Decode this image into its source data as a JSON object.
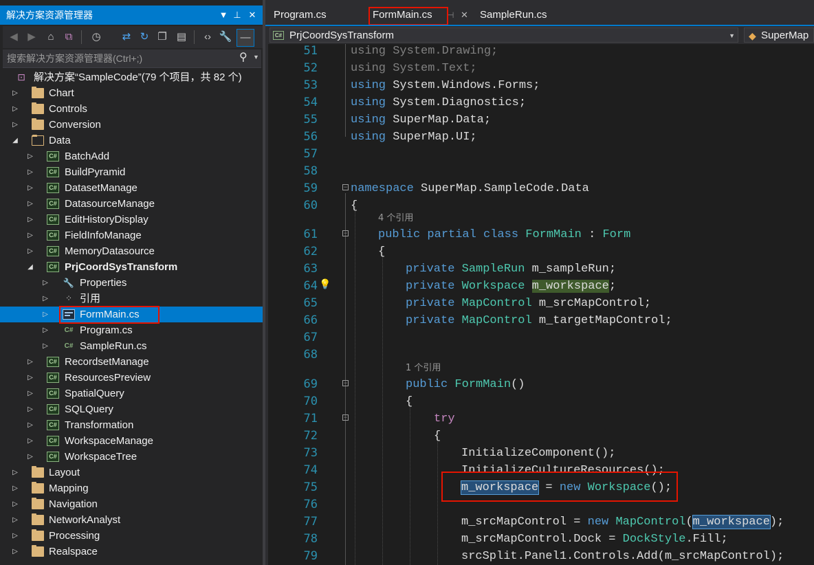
{
  "solution_explorer": {
    "title": "解决方案资源管理器",
    "search_placeholder": "搜索解决方案资源管理器(Ctrl+;)",
    "solution_label": "解决方案“SampleCode”(79 个项目，共 82 个)",
    "items": [
      {
        "label": "Chart",
        "type": "folder"
      },
      {
        "label": "Controls",
        "type": "folder"
      },
      {
        "label": "Conversion",
        "type": "folder"
      },
      {
        "label": "Data",
        "type": "folder"
      },
      {
        "label": "BatchAdd",
        "type": "csproj"
      },
      {
        "label": "BuildPyramid",
        "type": "csproj"
      },
      {
        "label": "DatasetManage",
        "type": "csproj"
      },
      {
        "label": "DatasourceManage",
        "type": "csproj"
      },
      {
        "label": "EditHistoryDisplay",
        "type": "csproj"
      },
      {
        "label": "FieldInfoManage",
        "type": "csproj"
      },
      {
        "label": "MemoryDatasource",
        "type": "csproj"
      },
      {
        "label": "PrjCoordSysTransform",
        "type": "csproj"
      },
      {
        "label": "Properties",
        "type": "properties"
      },
      {
        "label": "引用",
        "type": "references"
      },
      {
        "label": "FormMain.cs",
        "type": "form"
      },
      {
        "label": "Program.cs",
        "type": "csfile"
      },
      {
        "label": "SampleRun.cs",
        "type": "csfile"
      },
      {
        "label": "RecordsetManage",
        "type": "csproj"
      },
      {
        "label": "ResourcesPreview",
        "type": "csproj"
      },
      {
        "label": "SpatialQuery",
        "type": "csproj"
      },
      {
        "label": "SQLQuery",
        "type": "csproj"
      },
      {
        "label": "Transformation",
        "type": "csproj"
      },
      {
        "label": "WorkspaceManage",
        "type": "csproj"
      },
      {
        "label": "WorkspaceTree",
        "type": "csproj"
      },
      {
        "label": "Layout",
        "type": "folder"
      },
      {
        "label": "Mapping",
        "type": "folder"
      },
      {
        "label": "Navigation",
        "type": "folder"
      },
      {
        "label": "NetworkAnalyst",
        "type": "folder"
      },
      {
        "label": "Processing",
        "type": "folder"
      },
      {
        "label": "Realspace",
        "type": "folder"
      }
    ]
  },
  "editor": {
    "tabs": [
      {
        "label": "Program.cs"
      },
      {
        "label": "FormMain.cs"
      },
      {
        "label": "SampleRun.cs"
      }
    ],
    "nav_project": "PrjCoordSysTransform",
    "nav_member": "SuperMap",
    "line_numbers": [
      "51",
      "52",
      "53",
      "54",
      "55",
      "56",
      "57",
      "58",
      "59",
      "60",
      "61",
      "62",
      "63",
      "64",
      "65",
      "66",
      "67",
      "68",
      "69",
      "70",
      "71",
      "72",
      "73",
      "74",
      "75",
      "76",
      "77",
      "78",
      "79"
    ],
    "refs": {
      "class_refs": "4 个引用",
      "ctor_refs": "1 个引用"
    },
    "code": {
      "l51_kw": "using",
      "l51_rest": " System.Drawing;",
      "l52_kw": "using",
      "l52_rest": " System.Text;",
      "l53_kw": "using",
      "l53_rest": " System.Windows.Forms;",
      "l54_kw": "using",
      "l54_rest": " System.Diagnostics;",
      "l55_kw": "using",
      "l55_rest": " SuperMap.Data;",
      "l56_kw": "using",
      "l56_rest": " SuperMap.UI;",
      "l59_kw": "namespace",
      "l59_rest": " SuperMap.SampleCode.Data",
      "brace_open": "{",
      "l61_kw": "public partial class",
      "l61_ty": " FormMain",
      "l61_mid": " : ",
      "l61_ty2": "Form",
      "l63_kw": "private",
      "l63_ty": " SampleRun",
      "l63_rest": " m_sampleRun;",
      "l64_kw": "private",
      "l64_ty": " Workspace",
      "l64_sp": " ",
      "l64_hl": "m_workspace",
      "l64_end": ";",
      "l65_kw": "private",
      "l65_ty": " MapControl",
      "l65_rest": " m_srcMapControl;",
      "l66_kw": "private",
      "l66_ty": " MapControl",
      "l66_rest": " m_targetMapControl;",
      "l69_kw": "public",
      "l69_ty": " FormMain",
      "l69_rest": "()",
      "l71_kw": "try",
      "l73": "InitializeComponent();",
      "l74": "InitializeCultureResources();",
      "l75_hl": "m_workspace",
      "l75_mid": " = ",
      "l75_kw": "new",
      "l75_ty": " Workspace",
      "l75_end": "();",
      "l77_pre": "m_srcMapControl = ",
      "l77_kw": "new",
      "l77_ty": " MapControl",
      "l77_paren": "(",
      "l77_hl": "m_workspace",
      "l77_end": ");",
      "l78_pre": "m_srcMapControl.Dock = ",
      "l78_ty": "DockStyle",
      "l78_end": ".Fill;",
      "l79": "srcSplit.Panel1.Controls.Add(m_srcMapControl);"
    }
  }
}
